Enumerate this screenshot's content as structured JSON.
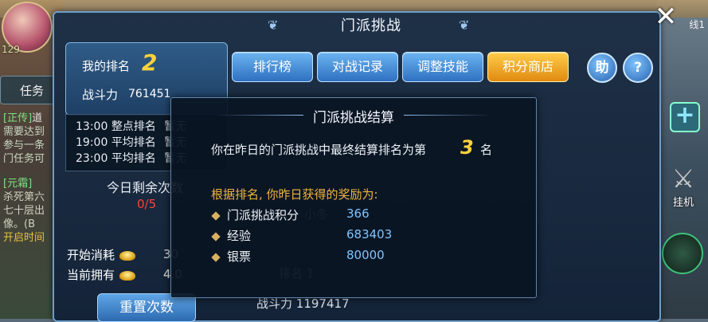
{
  "hud": {
    "hero_level": "129",
    "task_tab": "任务",
    "quest1_tag": "[正传]",
    "quest1_name": "道",
    "quest1_lines": [
      "需要达到",
      "参与一条",
      "门任务可"
    ],
    "quest2_tag": "[元霜]",
    "quest2_lines": [
      "杀死第六",
      "七十层出",
      "像。"
    ],
    "quest2_extra": "(B",
    "quest2_cta": "开启时间",
    "right_line": "线1",
    "right_plus": "+",
    "right_auto": "挂机"
  },
  "window": {
    "title": "门派挑战",
    "close": "✕"
  },
  "my_rank": {
    "rank_label": "我的排名",
    "rank_value": "2",
    "power_label": "战斗力",
    "power_value": "761451"
  },
  "schedule": [
    {
      "time": "13:00",
      "label": "整点排名",
      "status": "暂无"
    },
    {
      "time": "19:00",
      "label": "平均排名",
      "status": "暂无"
    },
    {
      "time": "23:00",
      "label": "平均排名",
      "status": "暂无"
    }
  ],
  "remaining": {
    "label": "今日剩余次数",
    "value": "0/5"
  },
  "costs": {
    "start_label": "开始消耗",
    "start_value": "30",
    "own_label": "当前拥有",
    "own_value": "4.0"
  },
  "reset_button": "重置次数",
  "tabs": [
    {
      "label": "排行榜",
      "active": false
    },
    {
      "label": "对战记录",
      "active": false
    },
    {
      "label": "调整技能",
      "active": false
    },
    {
      "label": "积分商店",
      "active": true
    }
  ],
  "help_button": "助",
  "question_button": "?",
  "opponent": {
    "name": "小冬",
    "rank_label": "排名",
    "rank_value": "1",
    "power_label": "战斗力",
    "power_value": "1197417"
  },
  "result_dialog": {
    "title": "门派挑战结算",
    "message": "你在昨日的门派挑战中最终结算排名为第",
    "rank": "3",
    "rank_unit": "名",
    "reward_head": "根据排名, 你昨日获得的奖励为:",
    "rewards": [
      {
        "name": "门派挑战积分",
        "value": "366"
      },
      {
        "name": "经验",
        "value": "683403"
      },
      {
        "name": "银票",
        "value": "80000"
      }
    ]
  }
}
